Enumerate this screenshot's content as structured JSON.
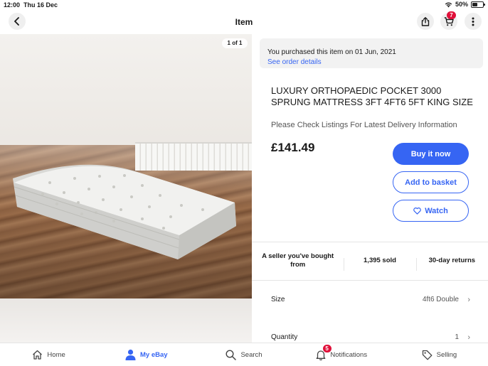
{
  "status_bar": {
    "time": "12:00",
    "date": "Thu 16 Dec",
    "battery": "50%",
    "battery_level": 0.5
  },
  "header": {
    "title": "Item",
    "cart_count": "7"
  },
  "image": {
    "counter": "1 of 1"
  },
  "purchase": {
    "text": "You purchased this item on 01 Jun, 2021",
    "link": "See order details"
  },
  "listing": {
    "title": "LUXURY ORTHOPAEDIC POCKET 3000 SPRUNG MATTRESS 3FT 4FT6 5FT KING SIZE",
    "subtitle": "Please Check Listings For Latest Delivery Information",
    "price": "£141.49"
  },
  "actions": {
    "buy": "Buy it now",
    "basket": "Add to basket",
    "watch": "Watch"
  },
  "features": [
    "A seller you've bought from",
    "1,395 sold",
    "30-day returns"
  ],
  "options": {
    "size": {
      "label": "Size",
      "value": "4ft6 Double"
    },
    "quantity": {
      "label": "Quantity",
      "value": "1"
    }
  },
  "nav": {
    "home": "Home",
    "myebay": "My eBay",
    "search": "Search",
    "notifications": "Notifications",
    "notifications_count": "5",
    "selling": "Selling"
  },
  "colors": {
    "accent": "#3665f3",
    "badge": "#e0103a"
  }
}
